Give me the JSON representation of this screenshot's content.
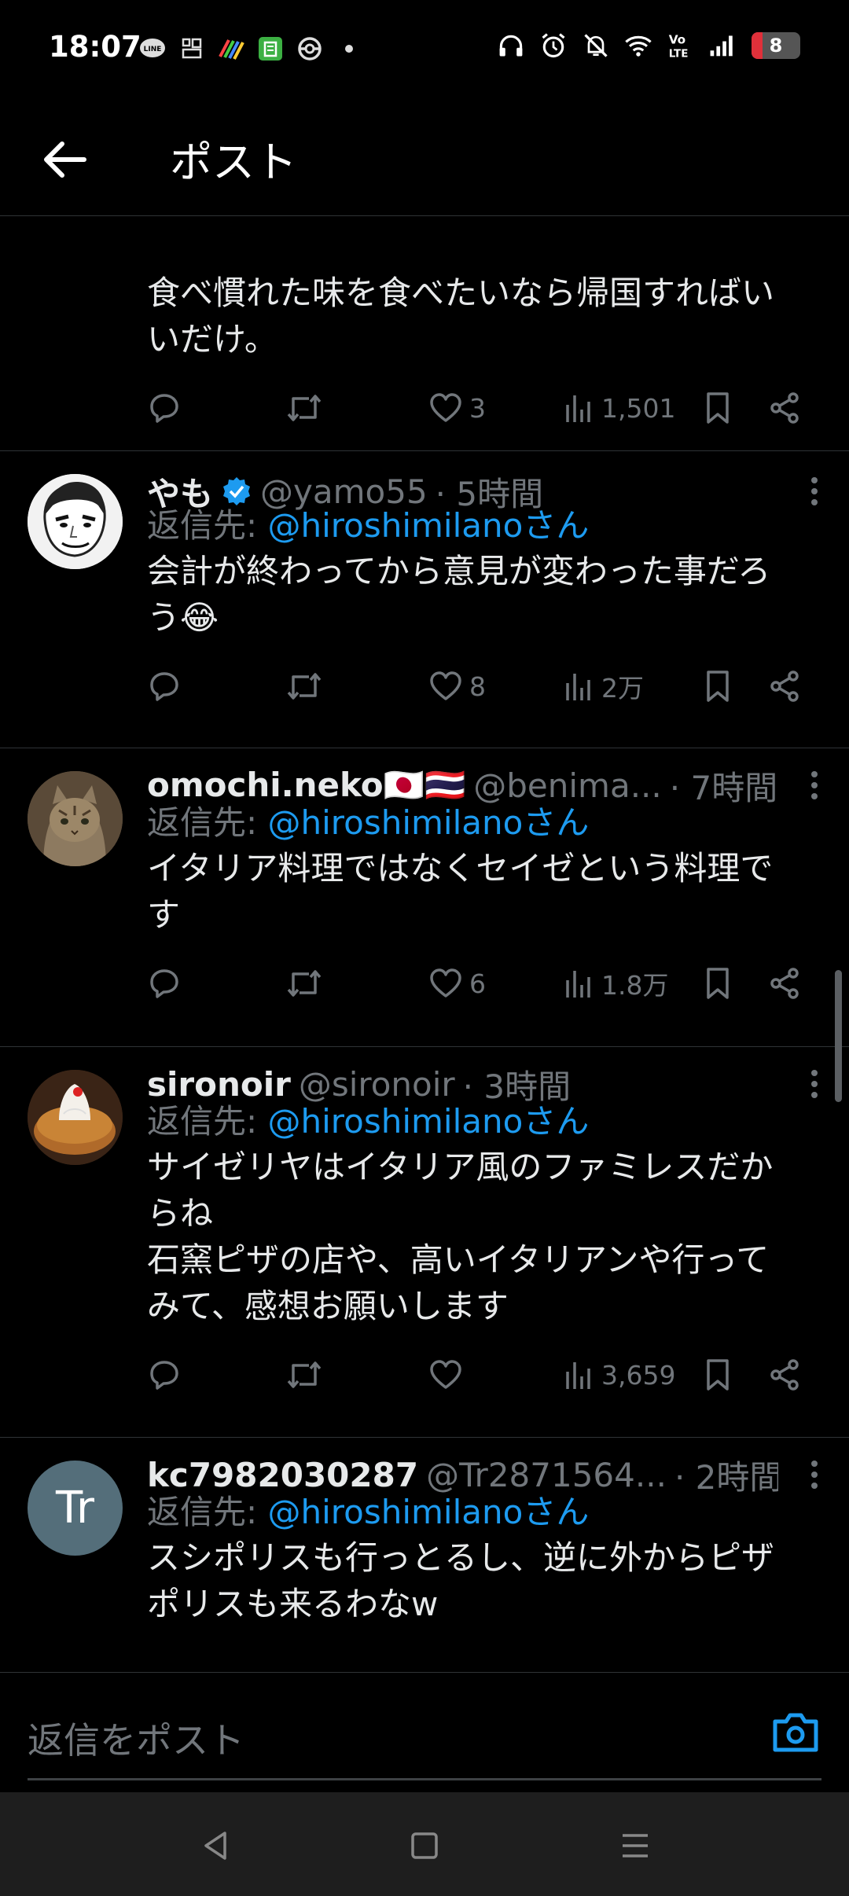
{
  "status_bar": {
    "time": "18:07",
    "left_icons": [
      "line-icon",
      "app-icon",
      "colorful-app-icon",
      "green-app-icon",
      "pokeball-icon",
      "dot-icon"
    ],
    "right_icons": [
      "headphones-icon",
      "alarm-icon",
      "mute-icon",
      "wifi-icon",
      "volte-icon",
      "signal-icon"
    ],
    "battery": "8",
    "accent": "#e0303a"
  },
  "header": {
    "title": "ポスト"
  },
  "colors": {
    "link": "#1d9bf0",
    "muted": "#71767b",
    "text": "#e7e9ea",
    "verified": "#1d9bf0"
  },
  "tweets": [
    {
      "partial_top_text": "食べ慣れた味を食べたいなら帰国すればい\nいだけ。",
      "likes": "3",
      "views": "1,501"
    },
    {
      "name": "やも",
      "verified": true,
      "handle": "@yamo55",
      "time": "· 5時間",
      "reply_prefix": "返信先: ",
      "reply_mention": "@hiroshimilanoさん",
      "text": "会計が終わってから意見が変わった事だろ\nう😂",
      "likes": "8",
      "views": "2万"
    },
    {
      "name": "omochi.neko🇯🇵🇹🇭",
      "handle": "@benima...",
      "time": "· 7時間",
      "reply_prefix": "返信先: ",
      "reply_mention": "@hiroshimilanoさん",
      "text": "イタリア料理ではなくセイゼという料理で\nす",
      "likes": "6",
      "views": "1.8万"
    },
    {
      "name": "sironoir",
      "handle": "@sironoir",
      "time": "· 3時間",
      "reply_prefix": "返信先: ",
      "reply_mention": "@hiroshimilanoさん",
      "text": "サイゼリヤはイタリア風のファミレスだか\nらね\n石窯ピザの店や、高いイタリアンや行って\nみて、感想お願いします",
      "likes": "",
      "views": "3,659"
    },
    {
      "name": "kc7982030287",
      "handle": "@Tr2871564...",
      "time": "· 2時間",
      "avatar_text": "Tr",
      "reply_prefix": "返信先: ",
      "reply_mention": "@hiroshimilanoさん",
      "text": "スシポリスも行っとるし、逆に外からピザ\nポリスも来るわなw"
    }
  ],
  "reply_bar": {
    "placeholder": "返信をポスト"
  },
  "nav": [
    "back-triangle-icon",
    "home-square-icon",
    "menu-lines-icon"
  ]
}
